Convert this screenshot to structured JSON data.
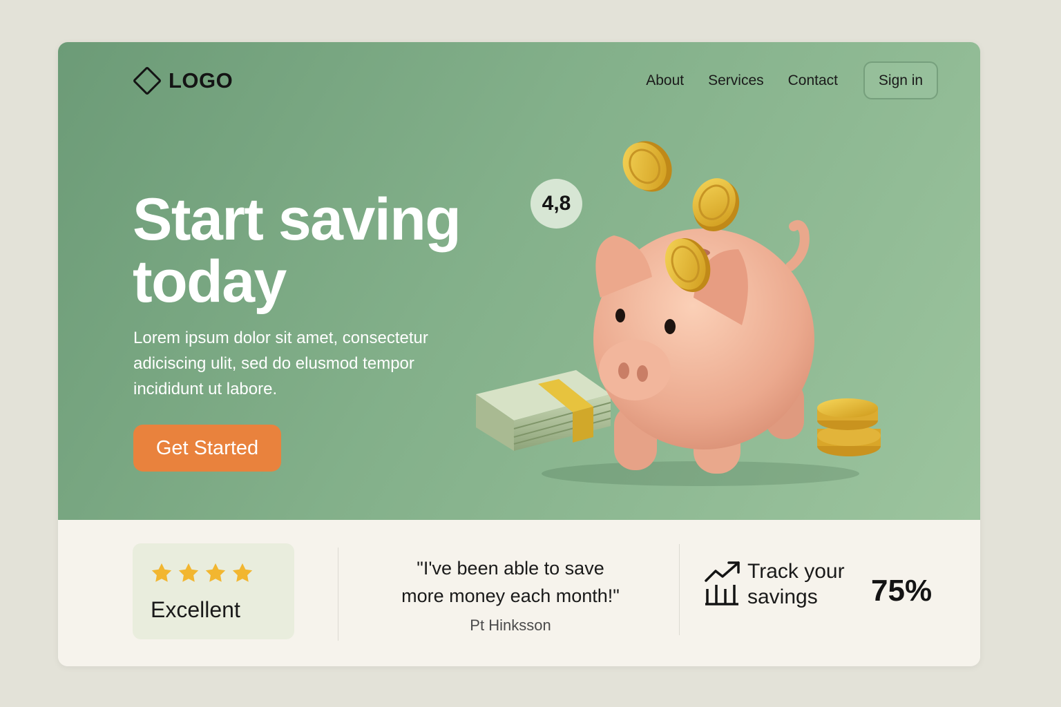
{
  "header": {
    "logo": "LOGO",
    "nav": [
      "About",
      "Services",
      "Contact"
    ],
    "signin": "Sign in"
  },
  "hero": {
    "headline_line1": "Start saving",
    "headline_line2": "today",
    "subtext": "Lorem ipsum dolor sit amet, consectetur adiciscing ulit, sed do elusmod tempor incididunt ut labore.",
    "cta": "Get Started",
    "rating": "4,8"
  },
  "features": {
    "rating_label": "Excellent",
    "stars": 4,
    "quote_line1": "\"I've been able to save",
    "quote_line2": "more money each month!\"",
    "author": "Pt Hinksson",
    "track_line1": "Track your",
    "track_line2": "savings",
    "percent": "75%"
  },
  "colors": {
    "accent": "#e9823d",
    "hero_green": "#83b08a",
    "star": "#f2b630"
  }
}
